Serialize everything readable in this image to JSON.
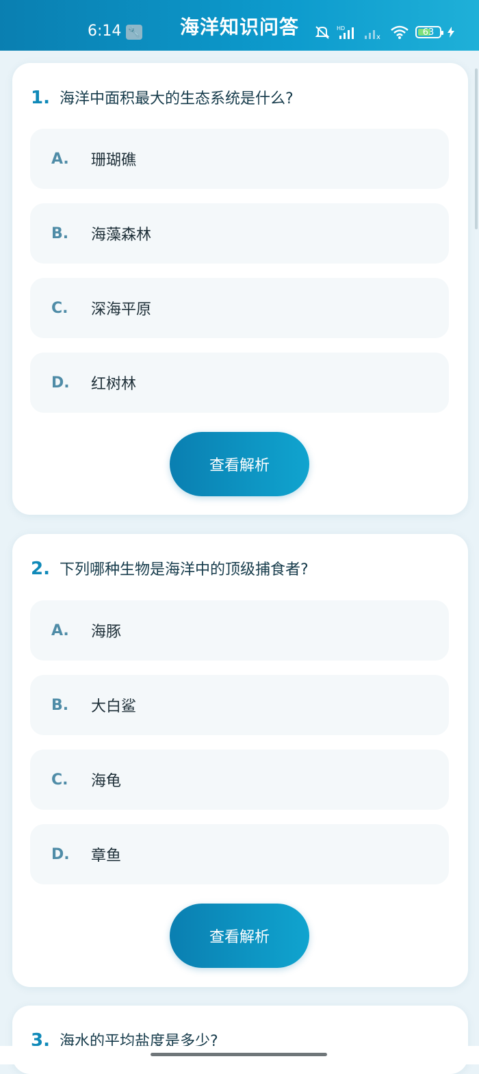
{
  "status_bar": {
    "time": "6:14",
    "wrench_icon": "🔧",
    "battery": "63",
    "icons": [
      "mute-bell-icon",
      "hd-signal-icon",
      "signal-icon",
      "wifi-icon",
      "battery-icon",
      "charging-icon"
    ]
  },
  "header": {
    "title": "海洋知识问答"
  },
  "questions": [
    {
      "number": "1.",
      "text": "海洋中面积最大的生态系统是什么?",
      "options": [
        {
          "letter": "A.",
          "text": "珊瑚礁"
        },
        {
          "letter": "B.",
          "text": "海藻森林"
        },
        {
          "letter": "C.",
          "text": "深海平原"
        },
        {
          "letter": "D.",
          "text": "红树林"
        }
      ],
      "button": "查看解析"
    },
    {
      "number": "2.",
      "text": "下列哪种生物是海洋中的顶级捕食者?",
      "options": [
        {
          "letter": "A.",
          "text": "海豚"
        },
        {
          "letter": "B.",
          "text": "大白鲨"
        },
        {
          "letter": "C.",
          "text": "海龟"
        },
        {
          "letter": "D.",
          "text": "章鱼"
        }
      ],
      "button": "查看解析"
    },
    {
      "number": "3.",
      "text": "海水的平均盐度是多少?"
    }
  ],
  "colors": {
    "accent": "#0f89b8",
    "header": "#0a7fb1",
    "background": "#e9f3f8"
  }
}
